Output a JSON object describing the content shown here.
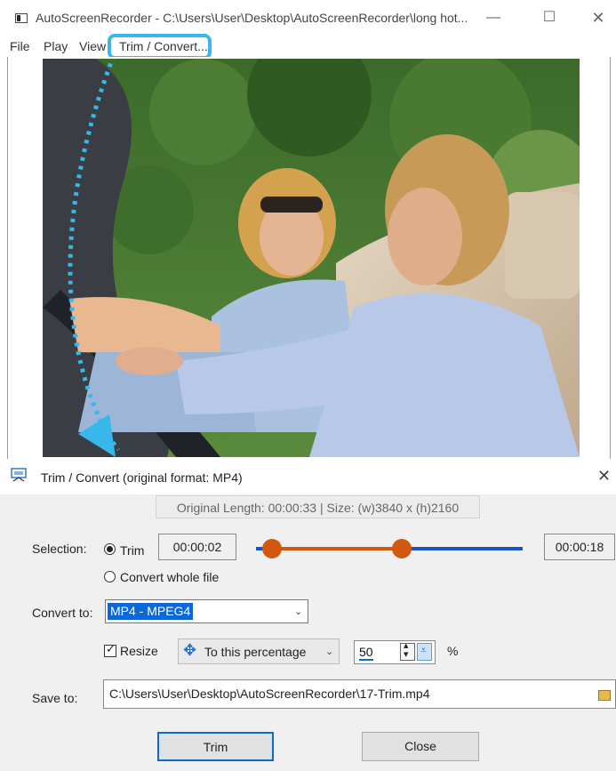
{
  "main_window": {
    "title": "AutoScreenRecorder - C:\\Users\\User\\Desktop\\AutoScreenRecorder\\long hot...",
    "controls": {
      "minimize": "—",
      "maximize": "☐",
      "close": "✕"
    },
    "menu": [
      "File",
      "Play",
      "View",
      "Trim / Convert..."
    ]
  },
  "dialog": {
    "title": "Trim / Convert  (original format: MP4)",
    "close": "✕",
    "info": "Original Length: 00:00:33   |  Size: (w)3840 x (h)2160",
    "selection_label": "Selection:",
    "trim_option": "Trim",
    "convert_option": "Convert whole file",
    "selected_mode": "trim",
    "start_time": "00:00:02",
    "end_time": "00:00:18",
    "slider": {
      "start_fraction": 0.06,
      "end_fraction": 0.55
    },
    "convert_to_label": "Convert to:",
    "convert_to_value": "MP4 - MPEG4",
    "resize_label": "Resize",
    "resize_checked": true,
    "resize_mode": "To this percentage",
    "resize_value": "50",
    "percent_sign": "%",
    "save_to_label": "Save to:",
    "save_path": "C:\\Users\\User\\Desktop\\AutoScreenRecorder\\17-Trim.mp4",
    "trim_button": "Trim",
    "close_button": "Close"
  },
  "colors": {
    "highlight": "#3cb8e8",
    "slider_selected": "#d2570f",
    "slider_track": "#1a53c9",
    "selection_blue": "#0b68d6"
  },
  "icons": [
    "app-icon",
    "trim-convert-dialog-icon",
    "move-arrows-icon",
    "folder-icon",
    "chevron-down-icon"
  ]
}
